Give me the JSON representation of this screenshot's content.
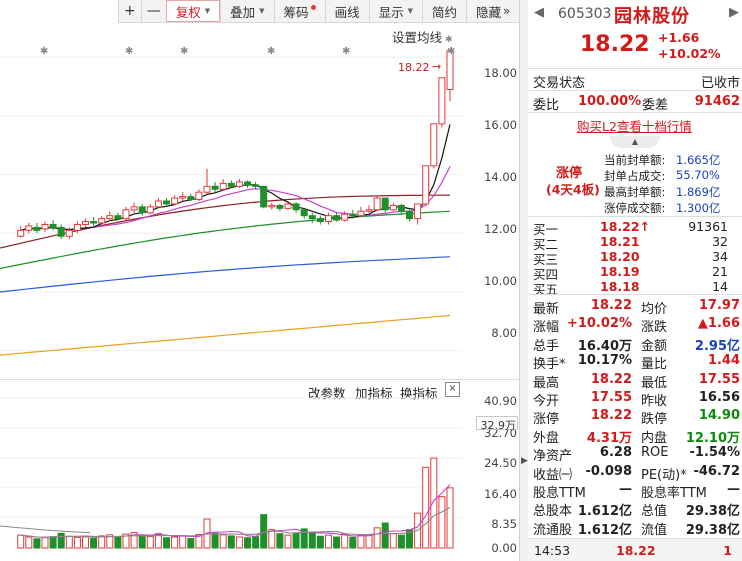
{
  "toolbar": {
    "plus": "+",
    "minus": "—",
    "items": [
      "复权",
      "叠加",
      "筹码",
      "画线",
      "显示",
      "简约",
      "隐藏"
    ],
    "more": "»"
  },
  "chart": {
    "settings_label": "设置均线",
    "settings_icon": "star-icon",
    "last_price_label": "18.22",
    "y_ticks": [
      "18.00",
      "16.00",
      "14.00",
      "12.00",
      "10.00",
      "8.00"
    ],
    "vol_ticks": [
      "40.90",
      "32.70",
      "24.50",
      "16.40",
      "8.35",
      "0.00"
    ],
    "vol_value": "32.9万",
    "mid_buttons": [
      "改参数",
      "加指标",
      "换指标"
    ],
    "close": "×",
    "colors": {
      "up": "#e23a3a",
      "down": "#1f8f2a",
      "ma5": "#111111",
      "ma10": "#c940c9",
      "ma20": "#8a2020",
      "ma30": "#1f8f2a",
      "ma60": "#2a5adf",
      "ma120": "#e8a21a"
    }
  },
  "chart_data": {
    "type": "candlestick",
    "ylim": [
      7.0,
      19.2
    ],
    "volume_ylim": [
      0,
      40.9
    ],
    "candles": [
      [
        11.9,
        12.1,
        12.25,
        11.85
      ],
      [
        12.1,
        12.25,
        12.35,
        12.0
      ],
      [
        12.2,
        12.1,
        12.35,
        12.0
      ],
      [
        12.15,
        12.3,
        12.4,
        12.05
      ],
      [
        12.3,
        12.2,
        12.45,
        12.1
      ],
      [
        12.2,
        11.9,
        12.3,
        11.8
      ],
      [
        11.9,
        12.1,
        12.2,
        11.8
      ],
      [
        12.1,
        12.3,
        12.4,
        12.0
      ],
      [
        12.3,
        12.4,
        12.5,
        12.2
      ],
      [
        12.4,
        12.35,
        12.55,
        12.25
      ],
      [
        12.35,
        12.5,
        12.6,
        12.3
      ],
      [
        12.5,
        12.6,
        12.75,
        12.4
      ],
      [
        12.6,
        12.5,
        12.7,
        12.45
      ],
      [
        12.5,
        12.8,
        12.9,
        12.45
      ],
      [
        12.8,
        12.9,
        13.05,
        12.7
      ],
      [
        12.9,
        12.7,
        13.0,
        12.6
      ],
      [
        12.7,
        12.9,
        13.0,
        12.65
      ],
      [
        12.9,
        13.1,
        13.2,
        12.85
      ],
      [
        13.1,
        13.0,
        13.2,
        12.95
      ],
      [
        13.0,
        13.2,
        13.3,
        12.95
      ],
      [
        13.2,
        13.25,
        13.4,
        13.1
      ],
      [
        13.25,
        13.15,
        13.35,
        13.1
      ],
      [
        13.15,
        13.4,
        13.5,
        13.1
      ],
      [
        13.4,
        13.6,
        14.2,
        13.35
      ],
      [
        13.6,
        13.5,
        13.75,
        13.4
      ],
      [
        13.5,
        13.7,
        13.85,
        13.45
      ],
      [
        13.7,
        13.6,
        13.8,
        13.55
      ],
      [
        13.6,
        13.75,
        13.85,
        13.55
      ],
      [
        13.75,
        13.65,
        13.8,
        13.55
      ],
      [
        13.65,
        13.6,
        13.75,
        13.5
      ],
      [
        13.6,
        12.9,
        13.6,
        12.85
      ],
      [
        12.9,
        12.95,
        13.05,
        12.8
      ],
      [
        12.95,
        12.85,
        13.0,
        12.75
      ],
      [
        12.85,
        13.0,
        13.1,
        12.8
      ],
      [
        13.0,
        12.8,
        13.05,
        12.7
      ],
      [
        12.8,
        12.6,
        12.85,
        12.5
      ],
      [
        12.6,
        12.5,
        12.7,
        12.35
      ],
      [
        12.5,
        12.4,
        12.6,
        12.3
      ],
      [
        12.4,
        12.6,
        12.7,
        12.3
      ],
      [
        12.6,
        12.45,
        12.7,
        12.4
      ],
      [
        12.45,
        12.65,
        12.75,
        12.4
      ],
      [
        12.65,
        12.6,
        12.8,
        12.5
      ],
      [
        12.6,
        12.75,
        12.9,
        12.55
      ],
      [
        12.75,
        12.8,
        12.95,
        12.7
      ],
      [
        12.8,
        13.2,
        13.25,
        12.75
      ],
      [
        13.2,
        12.8,
        13.2,
        12.7
      ],
      [
        12.8,
        12.95,
        13.05,
        12.75
      ],
      [
        12.95,
        12.75,
        13.0,
        12.65
      ],
      [
        12.75,
        12.5,
        12.8,
        12.4
      ],
      [
        12.5,
        13.0,
        13.0,
        12.3
      ],
      [
        13.0,
        14.3,
        14.3,
        12.95
      ],
      [
        14.3,
        15.73,
        15.73,
        14.2
      ],
      [
        15.73,
        17.3,
        17.3,
        15.6
      ],
      [
        16.9,
        18.22,
        18.22,
        16.5
      ]
    ],
    "volumes": [
      3.5,
      3.0,
      2.5,
      2.8,
      3.1,
      4.0,
      3.2,
      2.9,
      3.0,
      2.7,
      3.3,
      3.6,
      2.9,
      3.8,
      4.2,
      3.5,
      3.1,
      3.9,
      2.8,
      3.0,
      3.4,
      2.6,
      3.7,
      7.9,
      4.0,
      3.6,
      3.3,
      3.0,
      2.8,
      3.1,
      9.1,
      5.0,
      3.9,
      3.5,
      4.1,
      5.2,
      4.3,
      3.2,
      3.5,
      3.0,
      3.8,
      2.9,
      3.4,
      3.6,
      5.5,
      6.8,
      3.9,
      3.5,
      5.0,
      9.5,
      22.0,
      24.5,
      14.0,
      16.4
    ],
    "ma5_last": 15.1,
    "volume_ma": [
      6.0,
      5.2,
      4.6
    ]
  },
  "panel": {
    "nav_prev": "◀",
    "nav_next": "▶",
    "code": "605303",
    "name": "园林股份",
    "price": "18.22",
    "change": "+1.66",
    "pct": "+10.02%",
    "status_label": "交易状态",
    "status_value": "已收市",
    "wb_label": "委比",
    "wb_value": "100.00%",
    "wc_label": "委差",
    "wc_value": "91462",
    "l2_link": "购买L2查看十档行情",
    "l2_tab": "▲",
    "limit_title": "涨停",
    "limit_sub": "(4天4板)",
    "limit_rows": [
      {
        "k": "当前封单额:",
        "v": "1.665亿"
      },
      {
        "k": "封单占成交:",
        "v": "55.70%"
      },
      {
        "k": "最高封单额:",
        "v": "1.869亿"
      },
      {
        "k": "涨停成交额:",
        "v": "1.300亿"
      }
    ],
    "bids": [
      {
        "label": "买一",
        "price": "18.22↑",
        "vol": "91361"
      },
      {
        "label": "买二",
        "price": "18.21",
        "vol": "32"
      },
      {
        "label": "买三",
        "price": "18.20",
        "vol": "34"
      },
      {
        "label": "买四",
        "price": "18.19",
        "vol": "21"
      },
      {
        "label": "买五",
        "price": "18.18",
        "vol": "14"
      }
    ],
    "stats": [
      {
        "k1": "最新",
        "v1": "18.22",
        "c1": "red",
        "k2": "均价",
        "v2": "17.97",
        "c2": "red"
      },
      {
        "k1": "涨幅",
        "v1": "+10.02%",
        "c1": "red",
        "k2": "涨跌",
        "v2": "▲1.66",
        "c2": "red"
      },
      {
        "k1": "总手",
        "v1": "16.40万",
        "c1": "black",
        "k2": "金额",
        "v2": "2.95亿",
        "c2": "blue"
      },
      {
        "k1": "换手*",
        "v1": "10.17%",
        "c1": "black",
        "k2": "量比",
        "v2": "1.44",
        "c2": "red"
      },
      {
        "k1": "最高",
        "v1": "18.22",
        "c1": "red",
        "k2": "最低",
        "v2": "17.55",
        "c2": "red"
      },
      {
        "k1": "今开",
        "v1": "17.55",
        "c1": "red",
        "k2": "昨收",
        "v2": "16.56",
        "c2": "black"
      },
      {
        "k1": "涨停",
        "v1": "18.22",
        "c1": "red",
        "k2": "跌停",
        "v2": "14.90",
        "c2": "green"
      },
      {
        "k1": "外盘",
        "v1": "4.31万",
        "c1": "red",
        "k2": "内盘",
        "v2": "12.10万",
        "c2": "green"
      },
      {
        "k1": "净资产",
        "v1": "6.28",
        "c1": "black",
        "k2": "ROE",
        "v2": "-1.54%",
        "c2": "black"
      },
      {
        "k1": "收益㈠",
        "v1": "-0.098",
        "c1": "black",
        "k2": "PE(动)*",
        "v2": "-46.72",
        "c2": "black"
      },
      {
        "k1": "股息TTM",
        "v1": "—",
        "c1": "black",
        "k2": "股息率TTM",
        "v2": "—",
        "c2": "black"
      },
      {
        "k1": "总股本",
        "v1": "1.612亿",
        "c1": "black",
        "k2": "总值",
        "v2": "29.38亿",
        "c2": "black"
      },
      {
        "k1": "流通股",
        "v1": "1.612亿",
        "c1": "black",
        "k2": "流值",
        "v2": "29.38亿",
        "c2": "black"
      }
    ],
    "tick_time": "14:53",
    "tick_price": "18.22",
    "tick_vol": "1"
  }
}
